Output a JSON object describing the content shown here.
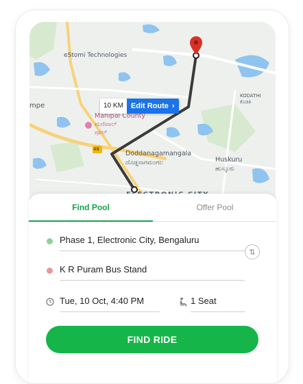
{
  "map": {
    "labels": {
      "company": "eStomi Technologies",
      "kompe": "mpe",
      "manipal": "Manipal County",
      "manipal_kn": "ಮಣಿಪಾಲ್",
      "pool": "ಪೂಲ್",
      "kodathi": "KODATHI",
      "kodathi_kn": "ಕೊಡತಿ",
      "doddanagamangala": "Doddanagamangala",
      "doddanagamangala_kn": "ದೊಡ್ಡನಾಗಮಂಗಲ",
      "huskuru": "Huskuru",
      "huskuru_kn": "ಹುಸ್ಕೂರು",
      "electronic_city": "ELECTRONIC CITY",
      "road_number": "48"
    },
    "distance": "10 KM",
    "edit_route": "Edit Route",
    "colors": {
      "route": "#3a3a3a",
      "pin": "#d93025",
      "water": "#8fc3f0",
      "park": "#c8e6c9",
      "road": "#f7d27a"
    }
  },
  "tabs": [
    {
      "label": "Find Pool",
      "active": true
    },
    {
      "label": "Offer Pool",
      "active": false
    }
  ],
  "form": {
    "from": "Phase 1, Electronic City, Bengaluru",
    "to": "K R Puram Bus Stand",
    "datetime": "Tue, 10 Oct, 4:40 PM",
    "seats": "1 Seat"
  },
  "actions": {
    "find_ride": "FIND RIDE"
  },
  "colors": {
    "accent": "#16a34a",
    "from_dot": "#8ed19b",
    "to_dot": "#e59a9a"
  }
}
